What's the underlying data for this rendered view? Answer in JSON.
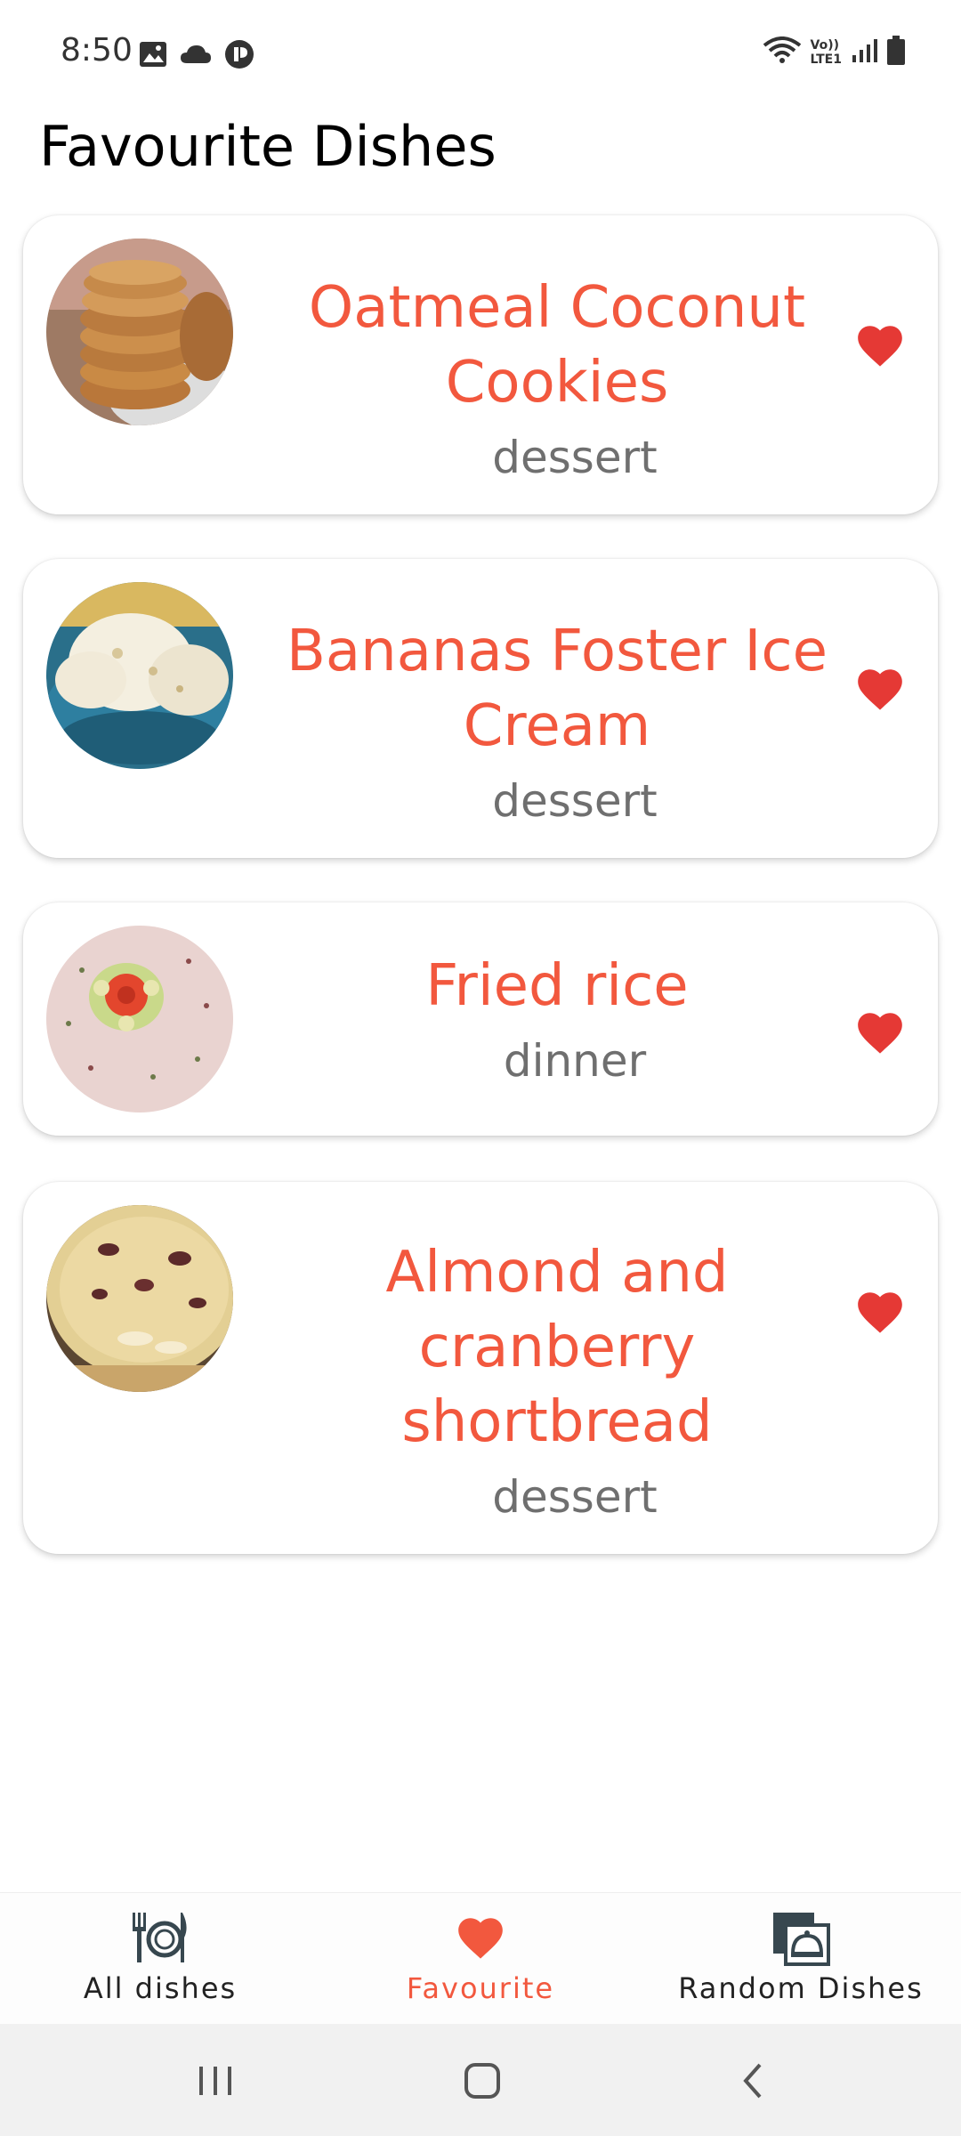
{
  "status_bar": {
    "time": "8:50",
    "left_icons": [
      "image-icon",
      "cloud-icon",
      "app-icon"
    ],
    "right_icons": [
      "wifi-icon",
      "volte-icon",
      "signal-icon",
      "battery-icon"
    ],
    "volte_text_top": "Vo))",
    "volte_text_bottom": "LTE1"
  },
  "page": {
    "title": "Favourite Dishes"
  },
  "dishes": [
    {
      "title": "Oatmeal Coconut Cookies",
      "category": "dessert",
      "favourite": true,
      "thumb": "cookies-image"
    },
    {
      "title": "Bananas Foster Ice Cream",
      "category": "dessert",
      "favourite": true,
      "thumb": "ice-cream-image"
    },
    {
      "title": "Fried rice",
      "category": "dinner",
      "favourite": true,
      "thumb": "fried-rice-image"
    },
    {
      "title": "Almond and cranberry shortbread",
      "category": "dessert",
      "favourite": true,
      "thumb": "shortbread-image"
    }
  ],
  "bottom_nav": {
    "items": [
      {
        "label": "All dishes",
        "icon": "plate-cutlery-icon",
        "active": false
      },
      {
        "label": "Favourite",
        "icon": "heart-icon",
        "active": true
      },
      {
        "label": "Random Dishes",
        "icon": "food-cloche-icon",
        "active": false
      }
    ]
  },
  "colors": {
    "accent": "#f2583e",
    "heart": "#e53935",
    "category_text": "#6f6f6f",
    "nav_icon": "#37474f"
  }
}
